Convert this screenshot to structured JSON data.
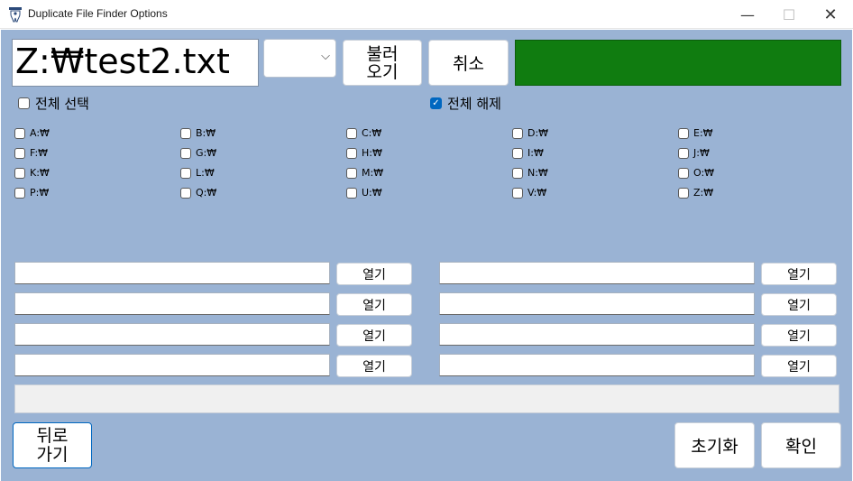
{
  "window": {
    "title": "Duplicate File Finder Options",
    "minimize_glyph": "—",
    "maximize_glyph": "☐",
    "close_glyph": "✕",
    "icon": "app-tooth-icon"
  },
  "top": {
    "path_value": "Z:₩test2.txt",
    "combo_value": "",
    "load_button": "불러\n오기",
    "cancel_button": "취소",
    "status_color": "#107c10"
  },
  "select_all": {
    "label": "전체 선택",
    "checked": false
  },
  "deselect_all": {
    "label": "전체 해제",
    "checked": true
  },
  "drives": [
    [
      "A:₩",
      "B:₩",
      "C:₩",
      "D:₩",
      "E:₩"
    ],
    [
      "F:₩",
      "G:₩",
      "H:₩",
      "I:₩",
      "J:₩"
    ],
    [
      "K:₩",
      "L:₩",
      "M:₩",
      "N:₩",
      "O:₩"
    ],
    [
      "P:₩",
      "Q:₩",
      "U:₩",
      "V:₩",
      "Z:₩"
    ]
  ],
  "folders": {
    "open_label": "열기",
    "left": [
      "",
      "",
      "",
      ""
    ],
    "right": [
      "",
      "",
      "",
      ""
    ]
  },
  "progress": {
    "value": 0
  },
  "bottom": {
    "back_button": "뒤로\n가기",
    "reset_button": "초기화",
    "ok_button": "확인"
  },
  "colors": {
    "client_bg": "#9ab3d4",
    "accent": "#0067c0",
    "status_green": "#107c10"
  }
}
